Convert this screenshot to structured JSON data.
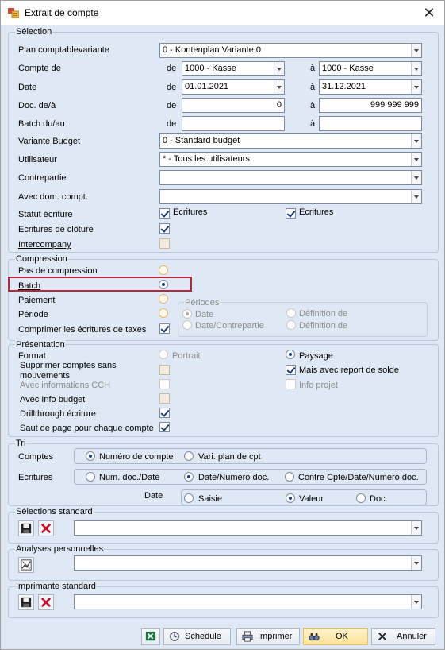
{
  "window": {
    "title": "Extrait de compte"
  },
  "selection": {
    "title": "Sélection",
    "plan_label": "Plan comptablevariante",
    "plan_value": "0 - Kontenplan Variante 0",
    "compte_label": "Compte de",
    "de": "de",
    "a": "à",
    "compte_from": "1000 - Kasse",
    "compte_to": "1000 - Kasse",
    "date_label": "Date",
    "date_from": "01.01.2021",
    "date_to": "31.12.2021",
    "doc_label": "Doc. de/à",
    "doc_from": "0",
    "doc_to": "999 999 999",
    "batch_label": "Batch du/au",
    "batch_from": "",
    "batch_to": "",
    "variante_label": "Variante Budget",
    "variante_value": "0 - Standard budget",
    "user_label": "Utilisateur",
    "user_value": "* - Tous les utilisateurs",
    "contre_label": "Contrepartie",
    "contre_value": "",
    "dom_label": "Avec dom.  compt.",
    "dom_value": "",
    "statut_label": "Statut écriture",
    "statut_opt1": "Ecritures",
    "statut_opt2": "Ecritures",
    "cloture_label": "Ecritures de clôture",
    "interco_label": "Intercompany"
  },
  "compression": {
    "title": "Compression",
    "pas": "Pas de compression",
    "batch": "Batch",
    "paiement": "Paiement",
    "periode": "Période",
    "taxes": "Comprimer les écritures de taxes",
    "periodes_title": "Périodes",
    "p_date": "Date",
    "p_datecontre": "Date/Contrepartie",
    "p_def1": "Définition de",
    "p_def2": "Définition de"
  },
  "presentation": {
    "title": "Présentation",
    "format": "Format",
    "portrait": "Portrait",
    "paysage": "Paysage",
    "suppr1": "Supprimer comptes sans",
    "suppr2": "mouvements",
    "mais_report": "Mais avec report de solde",
    "cch": "Avec informations CCH",
    "info_projet": "Info projet",
    "budget": "Avec Info budget",
    "drill": "Drillthrough écriture",
    "saut": "Saut de page pour chaque compte"
  },
  "tri": {
    "title": "Tri",
    "comptes": "Comptes",
    "num_compte": "Numéro de compte",
    "vari_plan": "Vari. plan de cpt",
    "ecritures": "Ecritures",
    "num_doc_date": "Num. doc./Date",
    "date_num_doc": "Date/Numéro doc.",
    "contre_cpte": "Contre Cpte/Date/Numéro doc.",
    "date": "Date",
    "saisie": "Saisie",
    "valeur": "Valeur",
    "doc": "Doc."
  },
  "standard": {
    "title": "Sélections standard",
    "value": ""
  },
  "analyses": {
    "title": "Analyses personnelles",
    "value": ""
  },
  "imprimante": {
    "title": "Imprimante standard",
    "value": ""
  },
  "buttons": {
    "schedule": "Schedule",
    "imprimer": "Imprimer",
    "ok": "OK",
    "annuler": "Annuler"
  }
}
